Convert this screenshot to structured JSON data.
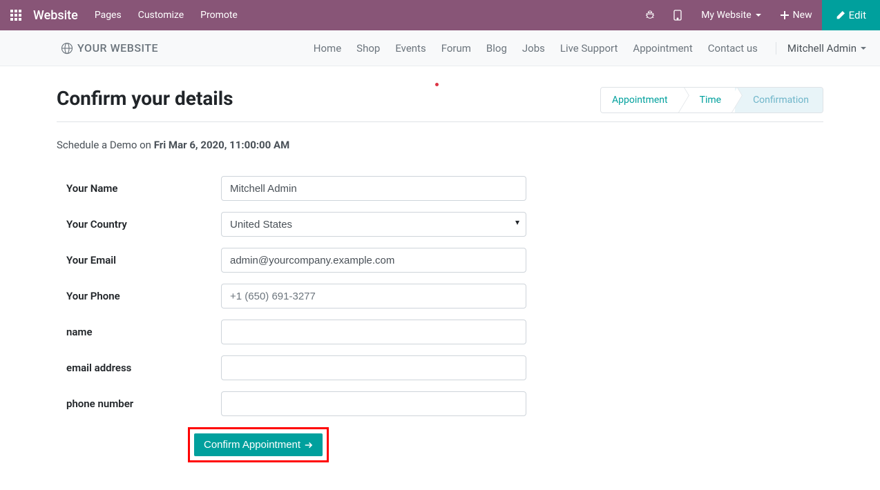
{
  "topbar": {
    "app_title": "Website",
    "menu": [
      "Pages",
      "Customize",
      "Promote"
    ],
    "my_website": "My Website",
    "new": "New",
    "edit": "Edit"
  },
  "site": {
    "logo_text": "YOUR WEBSITE",
    "nav": [
      "Home",
      "Shop",
      "Events",
      "Forum",
      "Blog",
      "Jobs",
      "Live Support",
      "Appointment",
      "Contact us"
    ],
    "user": "Mitchell Admin"
  },
  "page": {
    "title": "Confirm your details",
    "wizard": [
      "Appointment",
      "Time",
      "Confirmation"
    ],
    "schedule_prefix": "Schedule a Demo on ",
    "schedule_time": "Fri Mar 6, 2020, 11:00:00 AM"
  },
  "form": {
    "name_label": "Your Name",
    "name_value": "Mitchell Admin",
    "country_label": "Your Country",
    "country_value": "United States",
    "email_label": "Your Email",
    "email_value": "admin@yourcompany.example.com",
    "phone_label": "Your Phone",
    "phone_placeholder": "+1 (650) 691-3277",
    "phone_value": "",
    "f_name_label": "name",
    "f_name_value": "",
    "f_email_label": "email address",
    "f_email_value": "",
    "f_phone_label": "phone number",
    "f_phone_value": "",
    "confirm_label": "Confirm Appointment"
  }
}
